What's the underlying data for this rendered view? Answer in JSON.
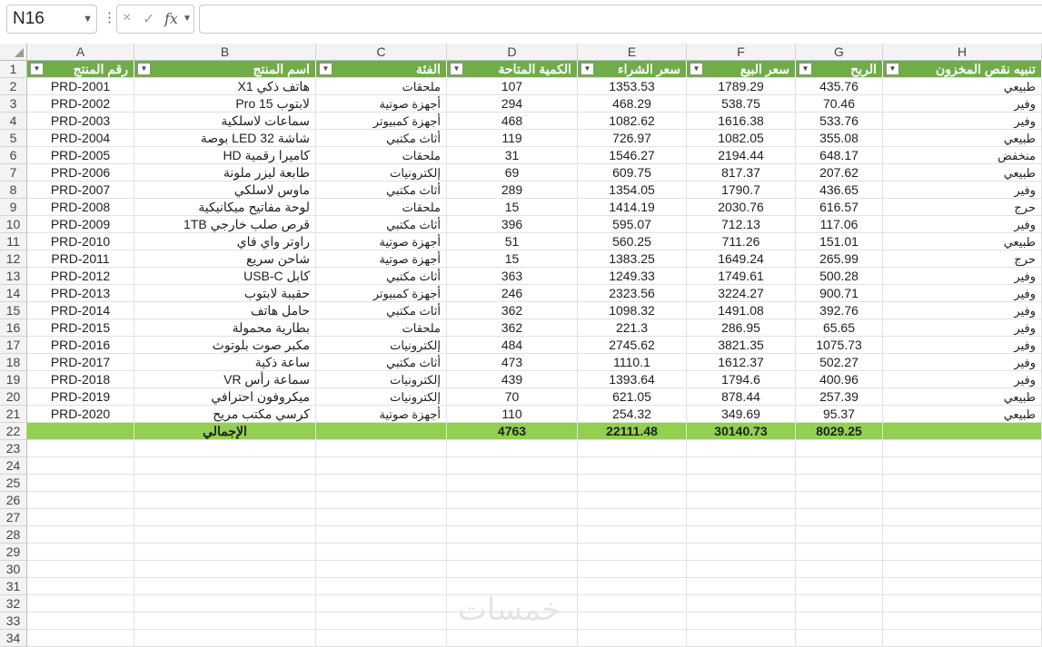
{
  "formula_bar": {
    "name_box": "N16",
    "cancel_icon": "×",
    "enter_icon": "✓",
    "fx_label": "fx",
    "formula": ""
  },
  "columns": [
    "A",
    "B",
    "C",
    "D",
    "E",
    "F",
    "G",
    "H"
  ],
  "headers": [
    "رقم المنتج",
    "اسم المنتج",
    "الفئة",
    "الكمية المتاحة",
    "سعر الشراء",
    "سعر البيع",
    "الربح",
    "تنبيه نقص المخزون"
  ],
  "rows": [
    [
      "PRD-2001",
      "هاتف ذكي X1",
      "ملحقات",
      "107",
      "1353.53",
      "1789.29",
      "435.76",
      "طبيعي"
    ],
    [
      "PRD-2002",
      "لابتوب Pro 15",
      "أجهزة صوتية",
      "294",
      "468.29",
      "538.75",
      "70.46",
      "وفير"
    ],
    [
      "PRD-2003",
      "سماعات لاسلكية",
      "أجهزة كمبيوتر",
      "468",
      "1082.62",
      "1616.38",
      "533.76",
      "وفير"
    ],
    [
      "PRD-2004",
      "شاشة LED 32 بوصة",
      "أثاث مكتبي",
      "119",
      "726.97",
      "1082.05",
      "355.08",
      "طبيعي"
    ],
    [
      "PRD-2005",
      "كاميرا رقمية HD",
      "ملحقات",
      "31",
      "1546.27",
      "2194.44",
      "648.17",
      "منخفض"
    ],
    [
      "PRD-2006",
      "طابعة ليزر ملونة",
      "إلكترونيات",
      "69",
      "609.75",
      "817.37",
      "207.62",
      "طبيعي"
    ],
    [
      "PRD-2007",
      "ماوس لاسلكي",
      "أثاث مكتبي",
      "289",
      "1354.05",
      "1790.7",
      "436.65",
      "وفير"
    ],
    [
      "PRD-2008",
      "لوحة مفاتيح ميكانيكية",
      "ملحقات",
      "15",
      "1414.19",
      "2030.76",
      "616.57",
      "حرج"
    ],
    [
      "PRD-2009",
      "قرص صلب خارجي 1TB",
      "أثاث مكتبي",
      "396",
      "595.07",
      "712.13",
      "117.06",
      "وفير"
    ],
    [
      "PRD-2010",
      "راوتر واي فاي",
      "أجهزة صوتية",
      "51",
      "560.25",
      "711.26",
      "151.01",
      "طبيعي"
    ],
    [
      "PRD-2011",
      "شاحن سريع",
      "أجهزة صوتية",
      "15",
      "1383.25",
      "1649.24",
      "265.99",
      "حرج"
    ],
    [
      "PRD-2012",
      "كابل USB-C",
      "أثاث مكتبي",
      "363",
      "1249.33",
      "1749.61",
      "500.28",
      "وفير"
    ],
    [
      "PRD-2013",
      "حقيبة لابتوب",
      "أجهزة كمبيوتر",
      "246",
      "2323.56",
      "3224.27",
      "900.71",
      "وفير"
    ],
    [
      "PRD-2014",
      "حامل هاتف",
      "أثاث مكتبي",
      "362",
      "1098.32",
      "1491.08",
      "392.76",
      "وفير"
    ],
    [
      "PRD-2015",
      "بطارية محمولة",
      "ملحقات",
      "362",
      "221.3",
      "286.95",
      "65.65",
      "وفير"
    ],
    [
      "PRD-2016",
      "مكبر صوت بلوتوث",
      "إلكترونيات",
      "484",
      "2745.62",
      "3821.35",
      "1075.73",
      "وفير"
    ],
    [
      "PRD-2017",
      "ساعة ذكية",
      "أثاث مكتبي",
      "473",
      "1110.1",
      "1612.37",
      "502.27",
      "وفير"
    ],
    [
      "PRD-2018",
      "سماعة رأس VR",
      "إلكترونيات",
      "439",
      "1393.64",
      "1794.6",
      "400.96",
      "وفير"
    ],
    [
      "PRD-2019",
      "ميكروفون احترافي",
      "إلكترونيات",
      "70",
      "621.05",
      "878.44",
      "257.39",
      "طبيعي"
    ],
    [
      "PRD-2020",
      "كرسي مكتب مريح",
      "أجهزة صوتية",
      "110",
      "254.32",
      "349.69",
      "95.37",
      "طبيعي"
    ]
  ],
  "totals": [
    "",
    "الإجمالي",
    "",
    "4763",
    "22111.48",
    "30140.73",
    "8029.25",
    ""
  ],
  "row_numbers": [
    "1",
    "2",
    "3",
    "4",
    "5",
    "6",
    "7",
    "8",
    "9",
    "10",
    "11",
    "12",
    "13",
    "14",
    "15",
    "16",
    "17",
    "18",
    "19",
    "20",
    "21",
    "22",
    "23",
    "24",
    "25",
    "26",
    "27",
    "28",
    "29",
    "30",
    "31",
    "32",
    "33",
    "34"
  ],
  "watermark": "خمسات",
  "colors": {
    "header_green": "#70ad47",
    "total_green": "#92d050"
  }
}
